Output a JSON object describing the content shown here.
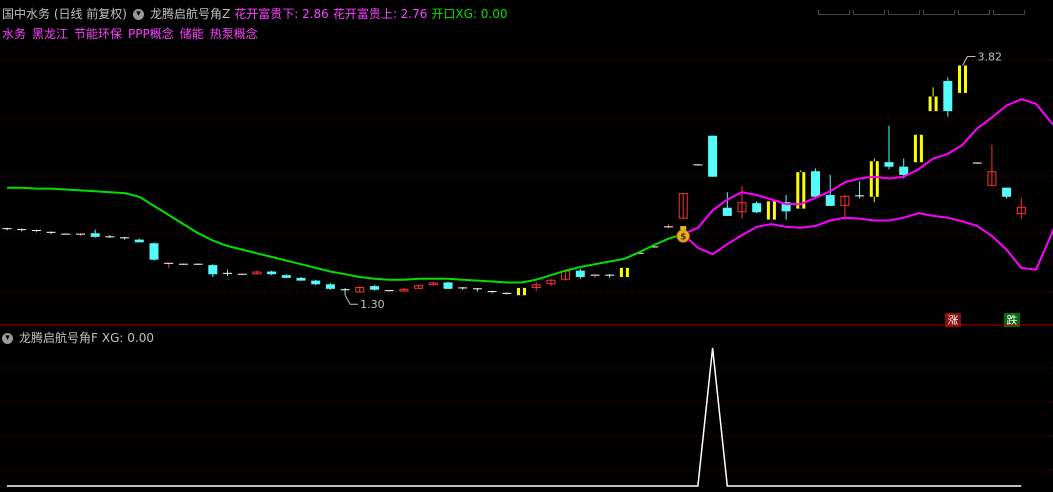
{
  "header": {
    "stock_title": "国中水务 (日线 前复权)",
    "indicator_name": "龙腾启航号角Z",
    "label_low": "花开富贵下: 2.86",
    "label_high": "花开富贵上: 2.76",
    "label_xg": "开口XG: 0.00",
    "concepts": [
      "水务",
      "黑龙江",
      "节能环保",
      "PPP概念",
      "储能",
      "热泵概念"
    ]
  },
  "sub_header": {
    "indicator_name": "龙腾启航号角F",
    "label_xg": "XG: 0.00"
  },
  "colors": {
    "up": "#ff3333",
    "down": "#54fcfc",
    "highlight": "#ffff00",
    "green_line": "#00e000",
    "magenta_line": "#ff00ff",
    "grid": "#7a0000",
    "text_grey": "#c0c0c0",
    "text_magenta": "#ff40ff",
    "text_green": "#00e000"
  },
  "icons": {
    "money_bag": "money-bag-icon",
    "collapse": "circle-chevron-icon"
  },
  "badges": {
    "rise": "涨",
    "fall": "跌"
  },
  "chart_data": [
    {
      "type": "candlestick",
      "ylim": [
        1.05,
        4.1
      ],
      "grid": true,
      "annotations": {
        "max": "3.82",
        "min": "1.30"
      },
      "candles": [
        {
          "o": 2.03,
          "h": 2.04,
          "l": 2.01,
          "c": 2.02
        },
        {
          "o": 2.02,
          "h": 2.03,
          "l": 2.0,
          "c": 2.01
        },
        {
          "o": 2.01,
          "h": 2.02,
          "l": 1.99,
          "c": 1.99
        },
        {
          "o": 1.99,
          "h": 2.0,
          "l": 1.97,
          "c": 1.98
        },
        {
          "o": 1.97,
          "h": 1.98,
          "l": 1.96,
          "c": 1.97
        },
        {
          "o": 1.96,
          "h": 1.98,
          "l": 1.95,
          "c": 1.97
        },
        {
          "o": 1.98,
          "h": 2.02,
          "l": 1.93,
          "c": 1.94
        },
        {
          "o": 1.94,
          "h": 1.96,
          "l": 1.93,
          "c": 1.93
        },
        {
          "o": 1.93,
          "h": 1.94,
          "l": 1.91,
          "c": 1.91
        },
        {
          "o": 1.91,
          "h": 1.92,
          "l": 1.88,
          "c": 1.88
        },
        {
          "o": 1.87,
          "h": 1.88,
          "l": 1.68,
          "c": 1.69
        },
        {
          "o": 1.64,
          "h": 1.65,
          "l": 1.6,
          "c": 1.65
        },
        {
          "o": 1.64,
          "h": 1.65,
          "l": 1.63,
          "c": 1.64
        },
        {
          "o": 1.64,
          "h": 1.65,
          "l": 1.63,
          "c": 1.64
        },
        {
          "o": 1.63,
          "h": 1.64,
          "l": 1.5,
          "c": 1.53
        },
        {
          "o": 1.54,
          "h": 1.58,
          "l": 1.51,
          "c": 1.52
        },
        {
          "o": 1.53,
          "h": 1.54,
          "l": 1.52,
          "c": 1.53
        },
        {
          "o": 1.53,
          "h": 1.57,
          "l": 1.53,
          "c": 1.56
        },
        {
          "o": 1.56,
          "h": 1.57,
          "l": 1.52,
          "c": 1.53
        },
        {
          "o": 1.52,
          "h": 1.53,
          "l": 1.49,
          "c": 1.49
        },
        {
          "o": 1.49,
          "h": 1.5,
          "l": 1.46,
          "c": 1.46
        },
        {
          "o": 1.46,
          "h": 1.47,
          "l": 1.41,
          "c": 1.42
        },
        {
          "o": 1.42,
          "h": 1.43,
          "l": 1.36,
          "c": 1.37
        },
        {
          "o": 1.36,
          "h": 1.38,
          "l": 1.3,
          "c": 1.35
        },
        {
          "o": 1.33,
          "h": 1.4,
          "l": 1.33,
          "c": 1.39
        },
        {
          "o": 1.4,
          "h": 1.41,
          "l": 1.35,
          "c": 1.36
        },
        {
          "o": 1.35,
          "h": 1.36,
          "l": 1.34,
          "c": 1.35
        },
        {
          "o": 1.34,
          "h": 1.38,
          "l": 1.34,
          "c": 1.37
        },
        {
          "o": 1.37,
          "h": 1.42,
          "l": 1.37,
          "c": 1.41
        },
        {
          "o": 1.41,
          "h": 1.45,
          "l": 1.41,
          "c": 1.44
        },
        {
          "o": 1.44,
          "h": 1.45,
          "l": 1.37,
          "c": 1.37
        },
        {
          "o": 1.38,
          "h": 1.39,
          "l": 1.36,
          "c": 1.37
        },
        {
          "o": 1.37,
          "h": 1.38,
          "l": 1.34,
          "c": 1.35
        },
        {
          "o": 1.34,
          "h": 1.35,
          "l": 1.32,
          "c": 1.33
        },
        {
          "o": 1.32,
          "h": 1.33,
          "l": 1.31,
          "c": 1.31
        },
        {
          "o": 1.3,
          "h": 1.38,
          "l": 1.3,
          "c": 1.38,
          "hl": true
        },
        {
          "o": 1.38,
          "h": 1.45,
          "l": 1.35,
          "c": 1.42
        },
        {
          "o": 1.42,
          "h": 1.48,
          "l": 1.4,
          "c": 1.47
        },
        {
          "o": 1.47,
          "h": 1.58,
          "l": 1.46,
          "c": 1.57
        },
        {
          "o": 1.57,
          "h": 1.59,
          "l": 1.48,
          "c": 1.5
        },
        {
          "o": 1.51,
          "h": 1.53,
          "l": 1.49,
          "c": 1.52
        },
        {
          "o": 1.52,
          "h": 1.53,
          "l": 1.49,
          "c": 1.5
        },
        {
          "o": 1.5,
          "h": 1.6,
          "l": 1.5,
          "c": 1.6,
          "hl": true
        },
        {
          "o": 1.76,
          "h": 1.77,
          "l": 1.75,
          "c": 1.76
        },
        {
          "o": 1.83,
          "h": 1.84,
          "l": 1.82,
          "c": 1.83
        },
        {
          "o": 2.05,
          "h": 2.08,
          "l": 2.03,
          "c": 2.05
        },
        {
          "o": 2.14,
          "h": 2.42,
          "l": 2.14,
          "c": 2.42
        },
        {
          "o": 2.73,
          "h": 2.74,
          "l": 2.72,
          "c": 2.73
        },
        {
          "o": 3.05,
          "h": 3.05,
          "l": 2.6,
          "c": 2.6
        },
        {
          "o": 2.26,
          "h": 2.43,
          "l": 2.17,
          "c": 2.17
        },
        {
          "o": 2.21,
          "h": 2.5,
          "l": 2.14,
          "c": 2.32
        },
        {
          "o": 2.31,
          "h": 2.33,
          "l": 2.2,
          "c": 2.21
        },
        {
          "o": 2.13,
          "h": 2.33,
          "l": 2.13,
          "c": 2.33,
          "hl": true
        },
        {
          "o": 2.32,
          "h": 2.4,
          "l": 2.13,
          "c": 2.22
        },
        {
          "o": 2.25,
          "h": 2.67,
          "l": 2.25,
          "c": 2.65,
          "hl": true
        },
        {
          "o": 2.66,
          "h": 2.69,
          "l": 2.38,
          "c": 2.38
        },
        {
          "o": 2.4,
          "h": 2.62,
          "l": 2.28,
          "c": 2.28
        },
        {
          "o": 2.28,
          "h": 2.4,
          "l": 2.13,
          "c": 2.39
        },
        {
          "o": 2.39,
          "h": 2.55,
          "l": 2.36,
          "c": 2.38
        },
        {
          "o": 2.38,
          "h": 2.8,
          "l": 2.32,
          "c": 2.77,
          "hl": true
        },
        {
          "o": 2.76,
          "h": 3.16,
          "l": 2.68,
          "c": 2.71
        },
        {
          "o": 2.71,
          "h": 2.8,
          "l": 2.58,
          "c": 2.62
        },
        {
          "o": 2.76,
          "h": 3.06,
          "l": 2.76,
          "c": 3.06,
          "hl": true
        },
        {
          "o": 3.32,
          "h": 3.58,
          "l": 3.32,
          "c": 3.48,
          "hl": true
        },
        {
          "o": 3.65,
          "h": 3.69,
          "l": 3.26,
          "c": 3.32
        },
        {
          "o": 3.52,
          "h": 3.82,
          "l": 3.52,
          "c": 3.82,
          "hl": true
        },
        {
          "o": 2.75,
          "h": 2.76,
          "l": 2.74,
          "c": 2.75
        },
        {
          "o": 2.5,
          "h": 2.95,
          "l": 2.5,
          "c": 2.66
        },
        {
          "o": 2.48,
          "h": 2.48,
          "l": 2.36,
          "c": 2.38
        },
        {
          "o": 2.19,
          "h": 2.37,
          "l": 2.14,
          "c": 2.27
        }
      ],
      "bag_marker_index": 46,
      "series": [
        {
          "color": "#00e000",
          "values": [
            2.48,
            2.48,
            2.47,
            2.47,
            2.46,
            2.45,
            2.44,
            2.43,
            2.42,
            2.38,
            2.28,
            2.18,
            2.08,
            1.98,
            1.9,
            1.84,
            1.8,
            1.76,
            1.72,
            1.68,
            1.64,
            1.6,
            1.56,
            1.53,
            1.5,
            1.48,
            1.47,
            1.47,
            1.48,
            1.48,
            1.48,
            1.47,
            1.46,
            1.45,
            1.44,
            1.44,
            1.47,
            1.52,
            1.57,
            1.61,
            1.64,
            1.67,
            1.7,
            1.77,
            1.85,
            1.92,
            1.97
          ]
        },
        {
          "color": "#ff00ff",
          "offset": 46,
          "values": [
            1.97,
            2.04,
            2.23,
            2.35,
            2.43,
            2.4,
            2.35,
            2.3,
            2.3,
            2.37,
            2.44,
            2.54,
            2.58,
            2.6,
            2.58,
            2.6,
            2.68,
            2.8,
            2.85,
            2.95,
            3.13,
            3.25,
            3.38,
            3.45,
            3.4,
            3.2,
            3.05,
            2.85
          ]
        },
        {
          "color": "#ff00ff",
          "offset": 46,
          "values": [
            1.97,
            1.82,
            1.75,
            1.86,
            1.96,
            2.05,
            2.08,
            2.05,
            2.04,
            2.06,
            2.12,
            2.15,
            2.14,
            2.12,
            2.12,
            2.15,
            2.2,
            2.17,
            2.15,
            2.11,
            2.06,
            1.95,
            1.8,
            1.6,
            1.58,
            1.95,
            2.33,
            2.54
          ]
        }
      ]
    },
    {
      "type": "line",
      "ylim": [
        0,
        1
      ],
      "grid": true,
      "series": [
        {
          "color": "#ffffff",
          "values": [
            0,
            0,
            0,
            0,
            0,
            0,
            0,
            0,
            0,
            0,
            0,
            0,
            0,
            0,
            0,
            0,
            0,
            0,
            0,
            0,
            0,
            0,
            0,
            0,
            0,
            0,
            0,
            0,
            0,
            0,
            0,
            0,
            0,
            0,
            0,
            0,
            0,
            0,
            0,
            0,
            0,
            0,
            0,
            0,
            0,
            0,
            0,
            0,
            1,
            0,
            0,
            0,
            0,
            0,
            0,
            0,
            0,
            0,
            0,
            0,
            0,
            0,
            0,
            0,
            0,
            0,
            0,
            0,
            0,
            0
          ]
        }
      ]
    }
  ]
}
